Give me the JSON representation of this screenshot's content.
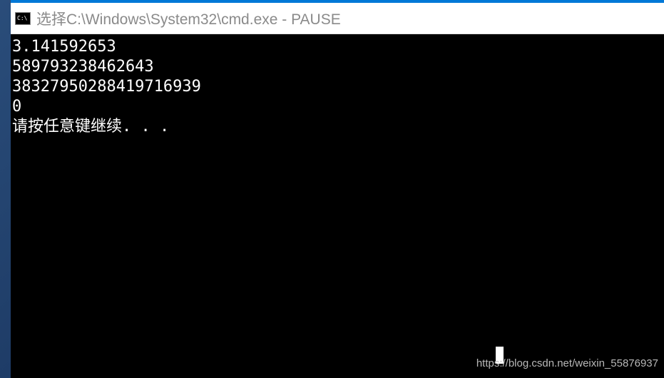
{
  "titlebar": {
    "icon_label": "C:\\",
    "title": "选择C:\\Windows\\System32\\cmd.exe - PAUSE"
  },
  "console": {
    "lines": [
      "3.141592653",
      "589793238462643",
      "38327950288419716939",
      "0",
      "请按任意键继续. . ."
    ]
  },
  "watermark": {
    "text": "https://blog.csdn.net/weixin_55876937"
  }
}
